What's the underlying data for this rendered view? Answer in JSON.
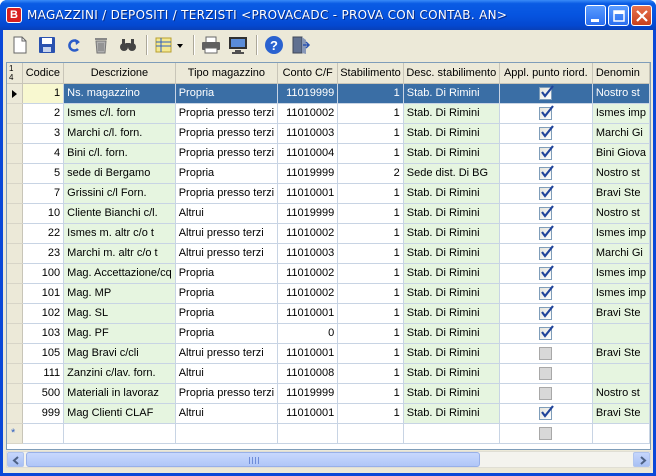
{
  "window": {
    "title": "MAGAZZINI / DEPOSITI / TERZISTI <PROVACADC - PROVA CON CONTAB. AN>",
    "app_icon_letter": "B",
    "controls": [
      "minimize-icon",
      "maximize-icon",
      "close-icon"
    ]
  },
  "toolbar": {
    "tools": [
      "new-document-icon",
      "save-icon",
      "undo-icon",
      "delete-icon",
      "find-icon",
      "column-layout-icon",
      "print-icon",
      "preview-monitor-icon",
      "help-icon",
      "exit-icon"
    ]
  },
  "grid": {
    "corner_text": "1\n4",
    "headers": [
      "Codice",
      "Descrizione",
      "Tipo magazzino",
      "Conto C/F",
      "Stabilimento",
      "Desc. stabilimento",
      "Appl. punto riord.",
      "Denomin"
    ],
    "selected_row": 0,
    "rows": [
      {
        "codice": "1",
        "descrizione": "Ns. magazzino",
        "tipo": "Propria",
        "conto": "11019999",
        "stab": "1",
        "desc_stab": "Stab. Di Rimini",
        "appl": true,
        "denom": "Nostro st"
      },
      {
        "codice": "2",
        "descrizione": "Ismes c/l. forn",
        "tipo": "Propria presso terzi",
        "conto": "11010002",
        "stab": "1",
        "desc_stab": "Stab. Di Rimini",
        "appl": true,
        "denom": "Ismes imp"
      },
      {
        "codice": "3",
        "descrizione": "Marchi c/l. forn.",
        "tipo": "Propria presso terzi",
        "conto": "11010003",
        "stab": "1",
        "desc_stab": "Stab. Di Rimini",
        "appl": true,
        "denom": "Marchi Gi"
      },
      {
        "codice": "4",
        "descrizione": "Bini c/l. forn.",
        "tipo": "Propria presso terzi",
        "conto": "11010004",
        "stab": "1",
        "desc_stab": "Stab. Di Rimini",
        "appl": true,
        "denom": "Bini Giova"
      },
      {
        "codice": "5",
        "descrizione": "sede di Bergamo",
        "tipo": "Propria",
        "conto": "11019999",
        "stab": "2",
        "desc_stab": "Sede dist. Di BG",
        "appl": true,
        "denom": "Nostro st"
      },
      {
        "codice": "7",
        "descrizione": "Grissini c/l Forn.",
        "tipo": "Propria presso terzi",
        "conto": "11010001",
        "stab": "1",
        "desc_stab": "Stab. Di Rimini",
        "appl": true,
        "denom": "Bravi Ste"
      },
      {
        "codice": "10",
        "descrizione": "Cliente Bianchi c/l.",
        "tipo": "Altrui",
        "conto": "11019999",
        "stab": "1",
        "desc_stab": "Stab. Di Rimini",
        "appl": true,
        "denom": "Nostro st"
      },
      {
        "codice": "22",
        "descrizione": "Ismes m. altr c/o t",
        "tipo": "Altrui presso terzi",
        "conto": "11010002",
        "stab": "1",
        "desc_stab": "Stab. Di Rimini",
        "appl": true,
        "denom": "Ismes imp"
      },
      {
        "codice": "23",
        "descrizione": "Marchi m. altr c/o t",
        "tipo": "Altrui presso terzi",
        "conto": "11010003",
        "stab": "1",
        "desc_stab": "Stab. Di Rimini",
        "appl": true,
        "denom": "Marchi Gi"
      },
      {
        "codice": "100",
        "descrizione": "Mag. Accettazione/cq",
        "tipo": "Propria",
        "conto": "11010002",
        "stab": "1",
        "desc_stab": "Stab. Di Rimini",
        "appl": true,
        "denom": "Ismes imp"
      },
      {
        "codice": "101",
        "descrizione": "Mag. MP",
        "tipo": "Propria",
        "conto": "11010002",
        "stab": "1",
        "desc_stab": "Stab. Di Rimini",
        "appl": true,
        "denom": "Ismes imp"
      },
      {
        "codice": "102",
        "descrizione": "Mag. SL",
        "tipo": "Propria",
        "conto": "11010001",
        "stab": "1",
        "desc_stab": "Stab. Di Rimini",
        "appl": true,
        "denom": "Bravi Ste"
      },
      {
        "codice": "103",
        "descrizione": "Mag. PF",
        "tipo": "Propria",
        "conto": "0",
        "stab": "1",
        "desc_stab": "Stab. Di Rimini",
        "appl": true,
        "denom": ""
      },
      {
        "codice": "105",
        "descrizione": "Mag Bravi c/cli",
        "tipo": "Altrui presso terzi",
        "conto": "11010001",
        "stab": "1",
        "desc_stab": "Stab. Di Rimini",
        "appl": false,
        "denom": "Bravi Ste"
      },
      {
        "codice": "111",
        "descrizione": "Zanzini c/lav. forn.",
        "tipo": "Altrui",
        "conto": "11010008",
        "stab": "1",
        "desc_stab": "Stab. Di Rimini",
        "appl": false,
        "denom": ""
      },
      {
        "codice": "500",
        "descrizione": "Materiali in lavoraz",
        "tipo": "Propria presso terzi",
        "conto": "11019999",
        "stab": "1",
        "desc_stab": "Stab. Di Rimini",
        "appl": false,
        "denom": "Nostro st"
      },
      {
        "codice": "999",
        "descrizione": "Mag Clienti CLAF",
        "tipo": "Altrui",
        "conto": "11010001",
        "stab": "1",
        "desc_stab": "Stab. Di Rimini",
        "appl": true,
        "denom": "Bravi Ste"
      }
    ],
    "new_row_marker": "*"
  },
  "colors": {
    "selection": "#3a6ea5",
    "focus_cell": "#f8f8d0",
    "alt_column": "#e6f5e0",
    "titlebar": "#0654e0"
  }
}
